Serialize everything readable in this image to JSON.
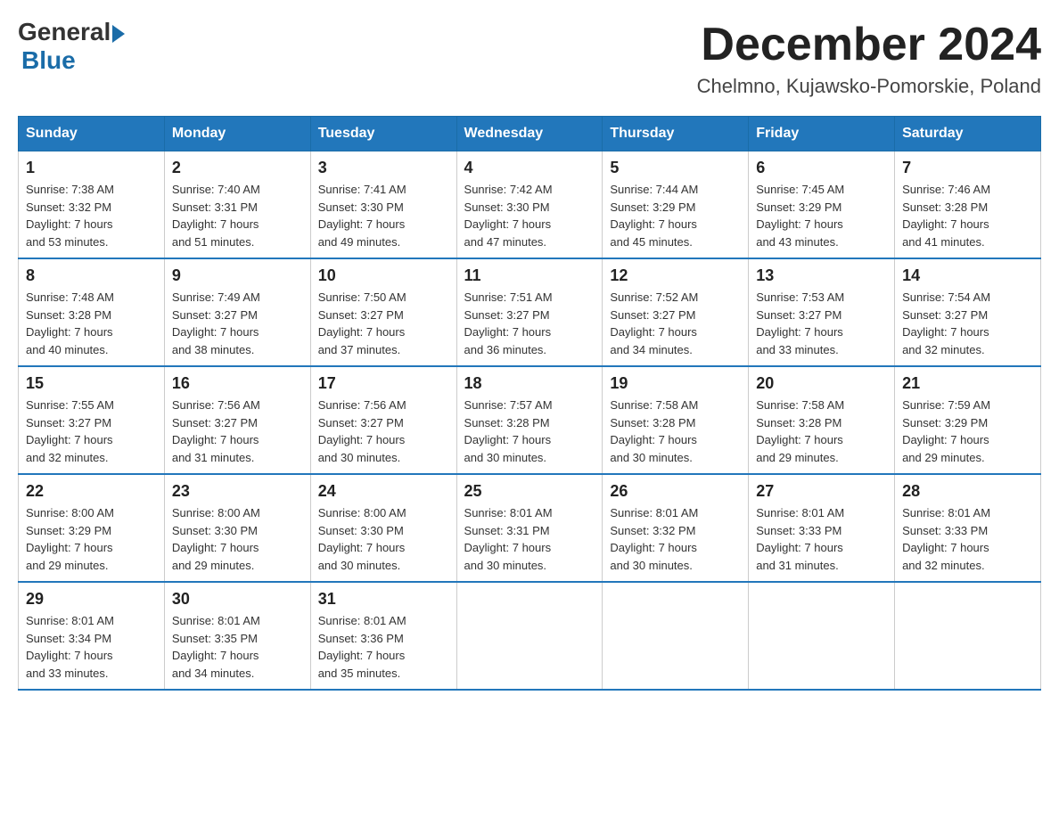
{
  "header": {
    "logo_general": "General",
    "logo_blue": "Blue",
    "month": "December 2024",
    "location": "Chelmno, Kujawsko-Pomorskie, Poland"
  },
  "days_of_week": [
    "Sunday",
    "Monday",
    "Tuesday",
    "Wednesday",
    "Thursday",
    "Friday",
    "Saturday"
  ],
  "weeks": [
    [
      {
        "day": "1",
        "sunrise": "7:38 AM",
        "sunset": "3:32 PM",
        "daylight": "7 hours and 53 minutes."
      },
      {
        "day": "2",
        "sunrise": "7:40 AM",
        "sunset": "3:31 PM",
        "daylight": "7 hours and 51 minutes."
      },
      {
        "day": "3",
        "sunrise": "7:41 AM",
        "sunset": "3:30 PM",
        "daylight": "7 hours and 49 minutes."
      },
      {
        "day": "4",
        "sunrise": "7:42 AM",
        "sunset": "3:30 PM",
        "daylight": "7 hours and 47 minutes."
      },
      {
        "day": "5",
        "sunrise": "7:44 AM",
        "sunset": "3:29 PM",
        "daylight": "7 hours and 45 minutes."
      },
      {
        "day": "6",
        "sunrise": "7:45 AM",
        "sunset": "3:29 PM",
        "daylight": "7 hours and 43 minutes."
      },
      {
        "day": "7",
        "sunrise": "7:46 AM",
        "sunset": "3:28 PM",
        "daylight": "7 hours and 41 minutes."
      }
    ],
    [
      {
        "day": "8",
        "sunrise": "7:48 AM",
        "sunset": "3:28 PM",
        "daylight": "7 hours and 40 minutes."
      },
      {
        "day": "9",
        "sunrise": "7:49 AM",
        "sunset": "3:27 PM",
        "daylight": "7 hours and 38 minutes."
      },
      {
        "day": "10",
        "sunrise": "7:50 AM",
        "sunset": "3:27 PM",
        "daylight": "7 hours and 37 minutes."
      },
      {
        "day": "11",
        "sunrise": "7:51 AM",
        "sunset": "3:27 PM",
        "daylight": "7 hours and 36 minutes."
      },
      {
        "day": "12",
        "sunrise": "7:52 AM",
        "sunset": "3:27 PM",
        "daylight": "7 hours and 34 minutes."
      },
      {
        "day": "13",
        "sunrise": "7:53 AM",
        "sunset": "3:27 PM",
        "daylight": "7 hours and 33 minutes."
      },
      {
        "day": "14",
        "sunrise": "7:54 AM",
        "sunset": "3:27 PM",
        "daylight": "7 hours and 32 minutes."
      }
    ],
    [
      {
        "day": "15",
        "sunrise": "7:55 AM",
        "sunset": "3:27 PM",
        "daylight": "7 hours and 32 minutes."
      },
      {
        "day": "16",
        "sunrise": "7:56 AM",
        "sunset": "3:27 PM",
        "daylight": "7 hours and 31 minutes."
      },
      {
        "day": "17",
        "sunrise": "7:56 AM",
        "sunset": "3:27 PM",
        "daylight": "7 hours and 30 minutes."
      },
      {
        "day": "18",
        "sunrise": "7:57 AM",
        "sunset": "3:28 PM",
        "daylight": "7 hours and 30 minutes."
      },
      {
        "day": "19",
        "sunrise": "7:58 AM",
        "sunset": "3:28 PM",
        "daylight": "7 hours and 30 minutes."
      },
      {
        "day": "20",
        "sunrise": "7:58 AM",
        "sunset": "3:28 PM",
        "daylight": "7 hours and 29 minutes."
      },
      {
        "day": "21",
        "sunrise": "7:59 AM",
        "sunset": "3:29 PM",
        "daylight": "7 hours and 29 minutes."
      }
    ],
    [
      {
        "day": "22",
        "sunrise": "8:00 AM",
        "sunset": "3:29 PM",
        "daylight": "7 hours and 29 minutes."
      },
      {
        "day": "23",
        "sunrise": "8:00 AM",
        "sunset": "3:30 PM",
        "daylight": "7 hours and 29 minutes."
      },
      {
        "day": "24",
        "sunrise": "8:00 AM",
        "sunset": "3:30 PM",
        "daylight": "7 hours and 30 minutes."
      },
      {
        "day": "25",
        "sunrise": "8:01 AM",
        "sunset": "3:31 PM",
        "daylight": "7 hours and 30 minutes."
      },
      {
        "day": "26",
        "sunrise": "8:01 AM",
        "sunset": "3:32 PM",
        "daylight": "7 hours and 30 minutes."
      },
      {
        "day": "27",
        "sunrise": "8:01 AM",
        "sunset": "3:33 PM",
        "daylight": "7 hours and 31 minutes."
      },
      {
        "day": "28",
        "sunrise": "8:01 AM",
        "sunset": "3:33 PM",
        "daylight": "7 hours and 32 minutes."
      }
    ],
    [
      {
        "day": "29",
        "sunrise": "8:01 AM",
        "sunset": "3:34 PM",
        "daylight": "7 hours and 33 minutes."
      },
      {
        "day": "30",
        "sunrise": "8:01 AM",
        "sunset": "3:35 PM",
        "daylight": "7 hours and 34 minutes."
      },
      {
        "day": "31",
        "sunrise": "8:01 AM",
        "sunset": "3:36 PM",
        "daylight": "7 hours and 35 minutes."
      },
      null,
      null,
      null,
      null
    ]
  ]
}
